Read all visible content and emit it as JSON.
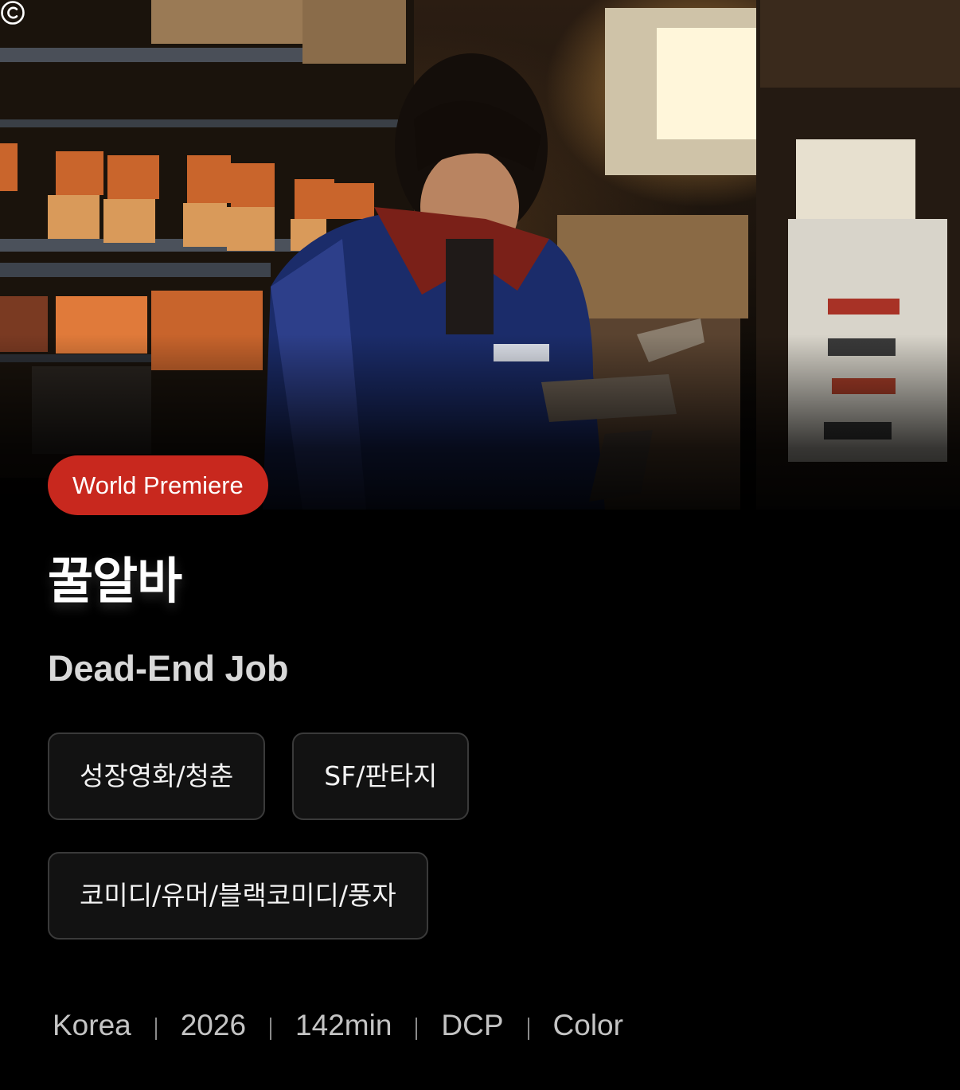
{
  "badge": {
    "label": "World Premiere",
    "color": "#c8281e"
  },
  "title": {
    "korean": "꿀알바",
    "english": "Dead-End Job"
  },
  "genres": [
    "성장영화/청춘",
    "SF/판타지",
    "코미디/유머/블랙코미디/풍자"
  ],
  "meta": {
    "country": "Korea",
    "year": "2026",
    "runtime": "142min",
    "format": "DCP",
    "color": "Color"
  },
  "icons": {
    "copyright": "copyright-icon"
  }
}
